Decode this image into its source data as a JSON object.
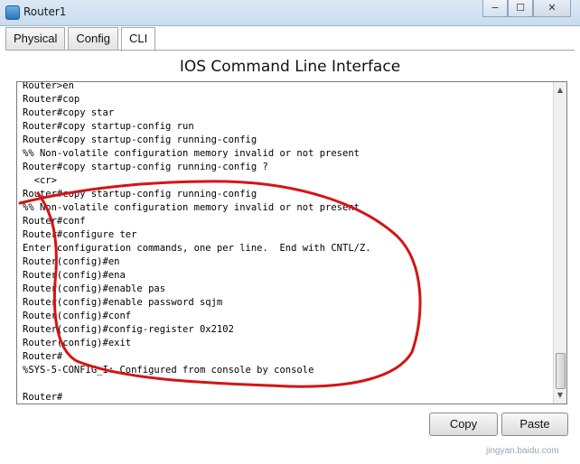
{
  "window": {
    "title": "Router1",
    "controls": [
      "−",
      "☐",
      "✕"
    ]
  },
  "tabs": [
    {
      "label": "Physical"
    },
    {
      "label": "Config"
    },
    {
      "label": "CLI",
      "active": true
    }
  ],
  "panel_title": "IOS Command Line Interface",
  "terminal": {
    "lines": [
      "Router>en",
      "Router#cop",
      "Router#copy star",
      "Router#copy startup-config run",
      "Router#copy startup-config running-config",
      "%% Non-volatile configuration memory invalid or not present",
      "Router#copy startup-config running-config ?",
      "  <cr>",
      "Router#copy startup-config running-config",
      "%% Non-volatile configuration memory invalid or not present",
      "Router#conf",
      "Router#configure ter",
      "Enter configuration commands, one per line.  End with CNTL/Z.",
      "Router(config)#en",
      "Router(config)#ena",
      "Router(config)#enable pas",
      "Router(config)#enable password sqjm",
      "Router(config)#conf",
      "Router(config)#config-register 0x2102",
      "Router(config)#exit",
      "Router#",
      "%SYS-5-CONFIG_I: Configured from console by console",
      "",
      "Router#"
    ]
  },
  "buttons": {
    "copy": "Copy",
    "paste": "Paste"
  },
  "watermark": "jingyan.baidu.com",
  "annotation_color": "#d41414"
}
